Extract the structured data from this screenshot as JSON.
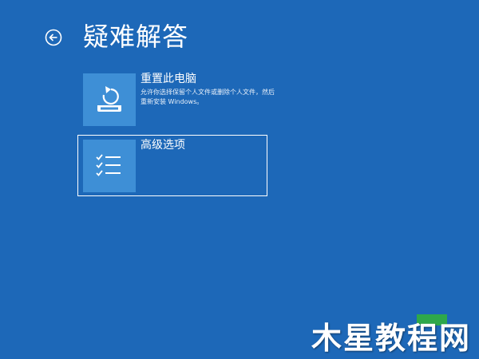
{
  "page": {
    "title": "疑难解答",
    "background_color": "#1d68b8"
  },
  "back_button": {
    "icon": "arrow-left-circle-icon"
  },
  "options": [
    {
      "title": "重置此电脑",
      "description": "允许你选择保留个人文件或删除个人文件，然后重新安装 Windows。",
      "icon": "reset-pc-icon",
      "focused": false
    },
    {
      "title": "高级选项",
      "description": "",
      "icon": "checklist-icon",
      "focused": true
    }
  ],
  "watermark": {
    "text": "木星教程网"
  },
  "colors": {
    "tile": "#3e8fd6",
    "focus_border": "#ffffff"
  }
}
